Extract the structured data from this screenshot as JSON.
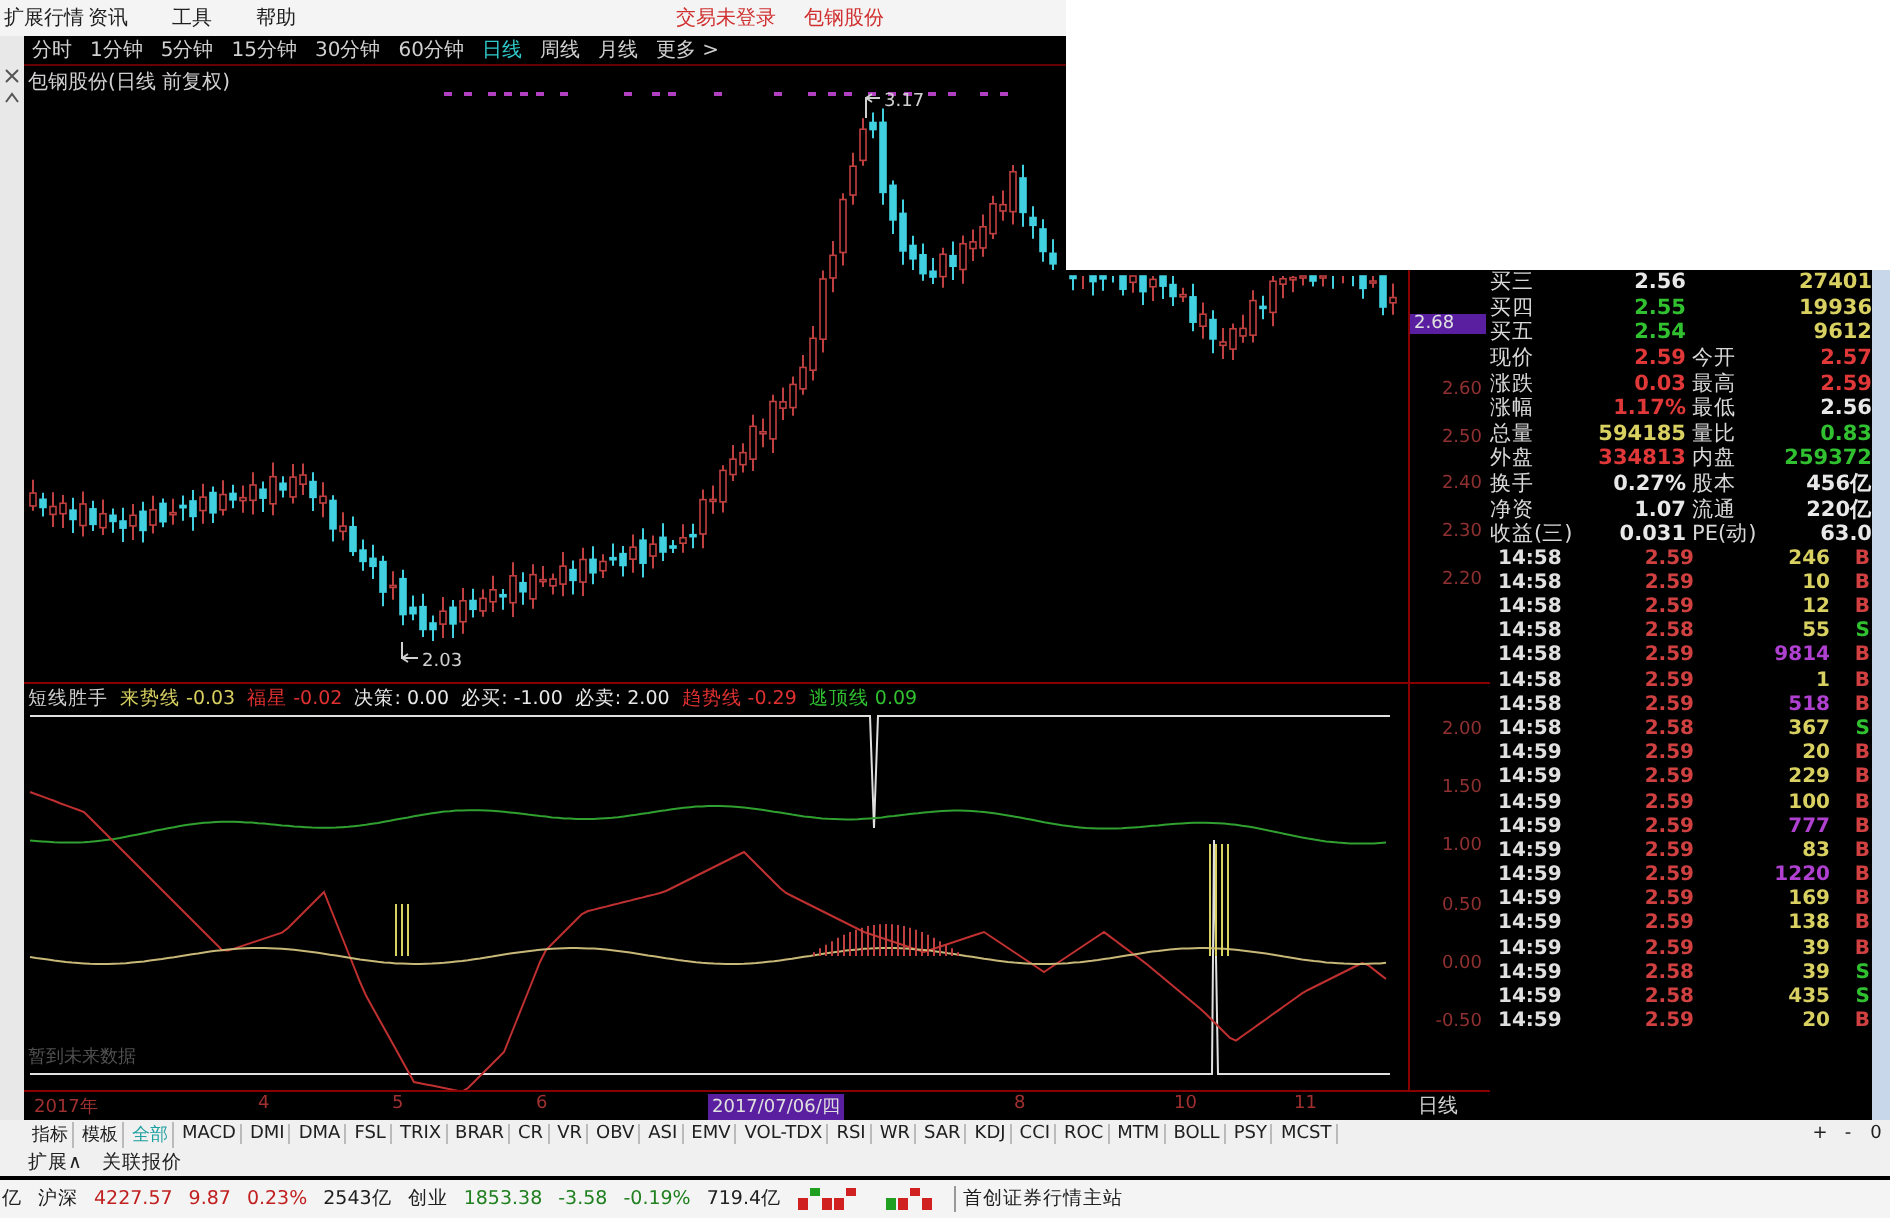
{
  "menu": {
    "items": [
      "扩展行情",
      "资讯",
      "工具",
      "帮助"
    ],
    "status": [
      "交易未登录",
      "包钢股份"
    ]
  },
  "periods": [
    {
      "label": "分时",
      "selected": false
    },
    {
      "label": "1分钟",
      "selected": false
    },
    {
      "label": "5分钟",
      "selected": false
    },
    {
      "label": "15分钟",
      "selected": false
    },
    {
      "label": "30分钟",
      "selected": false
    },
    {
      "label": "60分钟",
      "selected": false
    },
    {
      "label": "日线",
      "selected": true
    },
    {
      "label": "周线",
      "selected": false
    },
    {
      "label": "月线",
      "selected": false
    },
    {
      "label": "更多 >",
      "selected": false
    }
  ],
  "price_chart": {
    "title": "包钢股份(日线 前复权)",
    "high_label": "3.17",
    "low_label": "2.03",
    "cursor_price": "2.68",
    "axis_labels": [
      "2.60",
      "2.50",
      "2.40",
      "2.30",
      "2.20"
    ]
  },
  "indicator": {
    "name": "短线胜手",
    "legend": [
      {
        "label": "来势线",
        "value": "-0.03",
        "color": "#d8d060"
      },
      {
        "label": "福星",
        "value": "-0.02",
        "color": "#e03030"
      },
      {
        "label": "决策:",
        "value": "0.00",
        "color": "#e8e8e8"
      },
      {
        "label": "必买:",
        "value": "-1.00",
        "color": "#e8e8e8"
      },
      {
        "label": "必卖:",
        "value": "2.00",
        "color": "#e8e8e8"
      },
      {
        "label": "趋势线",
        "value": "-0.29",
        "color": "#e03030"
      },
      {
        "label": "逃顶线",
        "value": "0.09",
        "color": "#30c030"
      }
    ],
    "axis_labels": [
      "2.00",
      "1.50",
      "1.00",
      "0.50",
      "0.00",
      "-0.50"
    ],
    "note": "暂到未来数据"
  },
  "date_axis": [
    {
      "label": "2017年",
      "kind": "tick"
    },
    {
      "label": "4",
      "kind": "tick"
    },
    {
      "label": "5",
      "kind": "tick"
    },
    {
      "label": "6",
      "kind": "tick"
    },
    {
      "label": "2017/07/06/四",
      "kind": "cursor"
    },
    {
      "label": "8",
      "kind": "tick"
    },
    {
      "label": "10",
      "kind": "tick"
    },
    {
      "label": "11",
      "kind": "tick"
    }
  ],
  "period_label": "日线",
  "order_book": [
    {
      "label": "买三",
      "price": "2.56",
      "color": "#e8e8e8",
      "volume": "27401"
    },
    {
      "label": "买四",
      "price": "2.55",
      "color": "#30c030",
      "volume": "19936"
    },
    {
      "label": "买五",
      "price": "2.54",
      "color": "#30c030",
      "volume": "9612"
    }
  ],
  "quote": [
    {
      "left": {
        "label": "现价",
        "value": "2.59",
        "color": "#e03838"
      },
      "right": {
        "label": "今开",
        "value": "2.57",
        "color": "#e03838"
      }
    },
    {
      "left": {
        "label": "涨跌",
        "value": "0.03",
        "color": "#e03838"
      },
      "right": {
        "label": "最高",
        "value": "2.59",
        "color": "#e03838"
      }
    },
    {
      "left": {
        "label": "涨幅",
        "value": "1.17%",
        "color": "#e03838"
      },
      "right": {
        "label": "最低",
        "value": "2.56",
        "color": "#e8e8e8"
      }
    },
    {
      "left": {
        "label": "总量",
        "value": "594185",
        "color": "#d8d060"
      },
      "right": {
        "label": "量比",
        "value": "0.83",
        "color": "#30c030"
      }
    },
    {
      "left": {
        "label": "外盘",
        "value": "334813",
        "color": "#e03838"
      },
      "right": {
        "label": "内盘",
        "value": "259372",
        "color": "#30c030"
      }
    },
    {
      "left": {
        "label": "换手",
        "value": "0.27%",
        "color": "#e8e8e8"
      },
      "right": {
        "label": "股本",
        "value": "456亿",
        "color": "#e8e8e8"
      }
    },
    {
      "left": {
        "label": "净资",
        "value": "1.07",
        "color": "#e8e8e8"
      },
      "right": {
        "label": "流通",
        "value": "220亿",
        "color": "#e8e8e8"
      }
    },
    {
      "left": {
        "label": "收益(三)",
        "value": "0.031",
        "color": "#e8e8e8"
      },
      "right": {
        "label": "PE(动)",
        "value": "63.0",
        "color": "#e8e8e8"
      }
    }
  ],
  "ticks": [
    {
      "time": "14:58",
      "price": "2.59",
      "volume": "246",
      "color": "#d8d060",
      "side": "B",
      "kind": "buy"
    },
    {
      "time": "14:58",
      "price": "2.59",
      "volume": "10",
      "color": "#d8d060",
      "side": "B",
      "kind": "buy"
    },
    {
      "time": "14:58",
      "price": "2.59",
      "volume": "12",
      "color": "#d8d060",
      "side": "B",
      "kind": "buy"
    },
    {
      "time": "14:58",
      "price": "2.58",
      "volume": "55",
      "color": "#d8d060",
      "side": "S",
      "kind": "sell"
    },
    {
      "time": "14:58",
      "price": "2.59",
      "volume": "9814",
      "color": "#b040d0",
      "side": "B",
      "kind": "buy"
    },
    {
      "time": "14:58",
      "price": "2.59",
      "volume": "1",
      "color": "#d8d060",
      "side": "B",
      "kind": "buy"
    },
    {
      "time": "14:58",
      "price": "2.59",
      "volume": "518",
      "color": "#b040d0",
      "side": "B",
      "kind": "buy"
    },
    {
      "time": "14:58",
      "price": "2.58",
      "volume": "367",
      "color": "#d8d060",
      "side": "S",
      "kind": "sell"
    },
    {
      "time": "14:59",
      "price": "2.59",
      "volume": "20",
      "color": "#d8d060",
      "side": "B",
      "kind": "buy"
    },
    {
      "time": "14:59",
      "price": "2.59",
      "volume": "229",
      "color": "#d8d060",
      "side": "B",
      "kind": "buy"
    },
    {
      "time": "14:59",
      "price": "2.59",
      "volume": "100",
      "color": "#d8d060",
      "side": "B",
      "kind": "buy"
    },
    {
      "time": "14:59",
      "price": "2.59",
      "volume": "777",
      "color": "#b040d0",
      "side": "B",
      "kind": "buy"
    },
    {
      "time": "14:59",
      "price": "2.59",
      "volume": "83",
      "color": "#d8d060",
      "side": "B",
      "kind": "buy"
    },
    {
      "time": "14:59",
      "price": "2.59",
      "volume": "1220",
      "color": "#b040d0",
      "side": "B",
      "kind": "buy"
    },
    {
      "time": "14:59",
      "price": "2.59",
      "volume": "169",
      "color": "#d8d060",
      "side": "B",
      "kind": "buy"
    },
    {
      "time": "14:59",
      "price": "2.59",
      "volume": "138",
      "color": "#d8d060",
      "side": "B",
      "kind": "buy"
    },
    {
      "time": "14:59",
      "price": "2.59",
      "volume": "39",
      "color": "#d8d060",
      "side": "B",
      "kind": "buy"
    },
    {
      "time": "14:59",
      "price": "2.58",
      "volume": "39",
      "color": "#d8d060",
      "side": "S",
      "kind": "sell"
    },
    {
      "time": "14:59",
      "price": "2.58",
      "volume": "435",
      "color": "#d8d060",
      "side": "S",
      "kind": "sell"
    },
    {
      "time": "14:59",
      "price": "2.59",
      "volume": "20",
      "color": "#d8d060",
      "side": "B",
      "kind": "buy"
    }
  ],
  "indicator_tabs": [
    {
      "label": "指标",
      "selected": false
    },
    {
      "label": "模板",
      "selected": false
    },
    {
      "label": "全部",
      "selected": true
    },
    {
      "label": "MACD",
      "selected": false
    },
    {
      "label": "DMI",
      "selected": false
    },
    {
      "label": "DMA",
      "selected": false
    },
    {
      "label": "FSL",
      "selected": false
    },
    {
      "label": "TRIX",
      "selected": false
    },
    {
      "label": "BRAR",
      "selected": false
    },
    {
      "label": "CR",
      "selected": false
    },
    {
      "label": "VR",
      "selected": false
    },
    {
      "label": "OBV",
      "selected": false
    },
    {
      "label": "ASI",
      "selected": false
    },
    {
      "label": "EMV",
      "selected": false
    },
    {
      "label": "VOL-TDX",
      "selected": false
    },
    {
      "label": "RSI",
      "selected": false
    },
    {
      "label": "WR",
      "selected": false
    },
    {
      "label": "SAR",
      "selected": false
    },
    {
      "label": "KDJ",
      "selected": false
    },
    {
      "label": "CCI",
      "selected": false
    },
    {
      "label": "ROC",
      "selected": false
    },
    {
      "label": "MTM",
      "selected": false
    },
    {
      "label": "BOLL",
      "selected": false
    },
    {
      "label": "PSY",
      "selected": false
    },
    {
      "label": "MCST",
      "selected": false
    }
  ],
  "zoom_buttons": [
    "+",
    "-",
    "0"
  ],
  "extra_tabs": [
    "扩展∧",
    "关联报价"
  ],
  "status_bar": {
    "items": [
      {
        "text": "亿",
        "color": "#202020"
      },
      {
        "text": "沪深",
        "color": "#202020"
      },
      {
        "text": "4227.57",
        "color": "#c02020"
      },
      {
        "text": "9.87",
        "color": "#c02020"
      },
      {
        "text": "0.23%",
        "color": "#c02020"
      },
      {
        "text": "2543亿",
        "color": "#202020"
      },
      {
        "text": "创业",
        "color": "#202020"
      },
      {
        "text": "1853.38",
        "color": "#208020"
      },
      {
        "text": "-3.58",
        "color": "#208020"
      },
      {
        "text": "-0.19%",
        "color": "#208020"
      },
      {
        "text": "719.4亿",
        "color": "#202020"
      }
    ],
    "server": "首创证券行情主站"
  }
}
